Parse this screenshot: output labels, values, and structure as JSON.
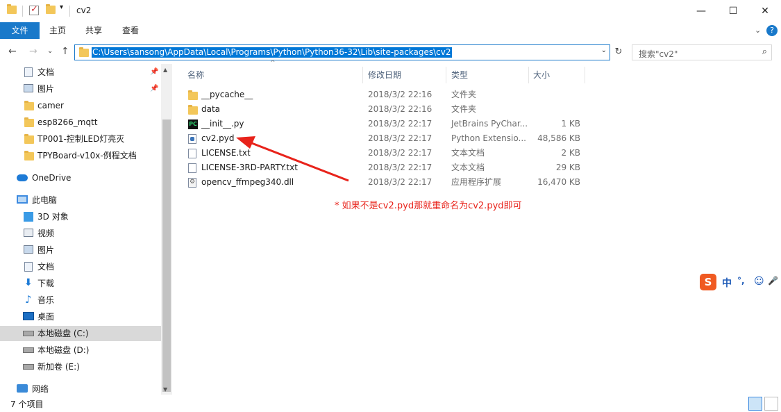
{
  "window": {
    "title": "cv2",
    "controls": {
      "minimize": "—",
      "maximize": "☐",
      "close": "✕"
    }
  },
  "ribbon": {
    "tabs": [
      "文件",
      "主页",
      "共享",
      "查看"
    ],
    "expand": "⌄",
    "help": "?"
  },
  "address": {
    "path": "C:\\Users\\sansong\\AppData\\Local\\Programs\\Python\\Python36-32\\Lib\\site-packages\\cv2",
    "dropdown": "⌄",
    "refresh": "↻"
  },
  "search": {
    "placeholder": "搜索\"cv2\"",
    "icon": "⌕"
  },
  "nav": {
    "back": "←",
    "forward": "→",
    "recent": "⌄",
    "up": "↑"
  },
  "sidebar": {
    "items": [
      {
        "label": "文档",
        "icon": "document-icon",
        "pinned": true
      },
      {
        "label": "图片",
        "icon": "picture-icon",
        "pinned": true
      },
      {
        "label": "camer",
        "icon": "folder-icon"
      },
      {
        "label": "esp8266_mqtt",
        "icon": "folder-icon"
      },
      {
        "label": "TP001-控制LED灯亮灭",
        "icon": "folder-icon"
      },
      {
        "label": "TPYBoard-v10x-例程文档",
        "icon": "folder-icon"
      },
      {
        "label": "OneDrive",
        "icon": "cloud-icon"
      },
      {
        "label": "此电脑",
        "icon": "pc-icon"
      },
      {
        "label": "3D 对象",
        "icon": "cube-icon"
      },
      {
        "label": "视频",
        "icon": "video-icon"
      },
      {
        "label": "图片",
        "icon": "picture-icon"
      },
      {
        "label": "文档",
        "icon": "document-icon"
      },
      {
        "label": "下载",
        "icon": "download-icon"
      },
      {
        "label": "音乐",
        "icon": "music-icon"
      },
      {
        "label": "桌面",
        "icon": "desktop-icon"
      },
      {
        "label": "本地磁盘 (C:)",
        "icon": "drive-icon",
        "selected": true
      },
      {
        "label": "本地磁盘 (D:)",
        "icon": "drive-icon"
      },
      {
        "label": "新加卷 (E:)",
        "icon": "drive-icon"
      },
      {
        "label": "网络",
        "icon": "network-icon"
      }
    ],
    "pin_glyph": "📌"
  },
  "columns": {
    "name": "名称",
    "date": "修改日期",
    "type": "类型",
    "size": "大小",
    "sort_glyph": "^"
  },
  "files": [
    {
      "name": "__pycache__",
      "date": "2018/3/2 22:16",
      "type": "文件夹",
      "size": "",
      "icon": "folder-icon"
    },
    {
      "name": "data",
      "date": "2018/3/2 22:16",
      "type": "文件夹",
      "size": "",
      "icon": "folder-icon"
    },
    {
      "name": "__init__.py",
      "date": "2018/3/2 22:17",
      "type": "JetBrains PyChar...",
      "size": "1 KB",
      "icon": "pycharm-icon"
    },
    {
      "name": "cv2.pyd",
      "date": "2018/3/2 22:17",
      "type": "Python Extensio...",
      "size": "48,586 KB",
      "icon": "python-extension-icon"
    },
    {
      "name": "LICENSE.txt",
      "date": "2018/3/2 22:17",
      "type": "文本文档",
      "size": "2 KB",
      "icon": "text-file-icon"
    },
    {
      "name": "LICENSE-3RD-PARTY.txt",
      "date": "2018/3/2 22:17",
      "type": "文本文档",
      "size": "29 KB",
      "icon": "text-file-icon"
    },
    {
      "name": "opencv_ffmpeg340.dll",
      "date": "2018/3/2 22:17",
      "type": "应用程序扩展",
      "size": "16,470 KB",
      "icon": "dll-icon"
    }
  ],
  "annotation": {
    "text": "* 如果不是cv2.pyd那就重命名为cv2.pyd即可",
    "color": "#e8231b"
  },
  "ime": {
    "logo": "S",
    "mode": "中",
    "punct": "°,",
    "emoji": "☺",
    "mic": "🎤"
  },
  "status": {
    "count": "7 个项目"
  },
  "colors": {
    "accent": "#1979ca",
    "selection": "#0078d7",
    "annotation": "#e8231b"
  }
}
